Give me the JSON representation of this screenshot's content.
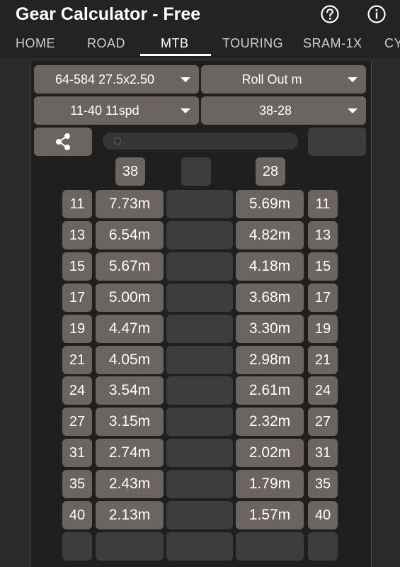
{
  "app": {
    "title": "Gear Calculator - Free"
  },
  "tabs": [
    "HOME",
    "ROAD",
    "MTB",
    "TOURING",
    "SRAM-1X",
    "CY"
  ],
  "active_tab": "MTB",
  "selectors": {
    "tire": "64-584 27.5x2.50",
    "unit": "Roll Out m",
    "cassette": "11-40 11spd",
    "chainrings": "38-28"
  },
  "chainrings": {
    "left": "38",
    "right": "28"
  },
  "rows": [
    {
      "cog": "11",
      "left": "7.73m",
      "right": "5.69m"
    },
    {
      "cog": "13",
      "left": "6.54m",
      "right": "4.82m"
    },
    {
      "cog": "15",
      "left": "5.67m",
      "right": "4.18m"
    },
    {
      "cog": "17",
      "left": "5.00m",
      "right": "3.68m"
    },
    {
      "cog": "19",
      "left": "4.47m",
      "right": "3.30m"
    },
    {
      "cog": "21",
      "left": "4.05m",
      "right": "2.98m"
    },
    {
      "cog": "24",
      "left": "3.54m",
      "right": "2.61m"
    },
    {
      "cog": "27",
      "left": "3.15m",
      "right": "2.32m"
    },
    {
      "cog": "31",
      "left": "2.74m",
      "right": "2.02m"
    },
    {
      "cog": "35",
      "left": "2.43m",
      "right": "1.79m"
    },
    {
      "cog": "40",
      "left": "2.13m",
      "right": "1.57m"
    }
  ],
  "icons": {
    "help": "help-circle-icon",
    "info": "info-circle-icon",
    "share": "share-icon",
    "dropdown": "caret-down-icon"
  },
  "colors": {
    "background": "#2a2a2a",
    "app_bar": "#232323",
    "button": "#6b6461",
    "empty_cell": "#3d3d3d",
    "text": "#ffffff"
  }
}
